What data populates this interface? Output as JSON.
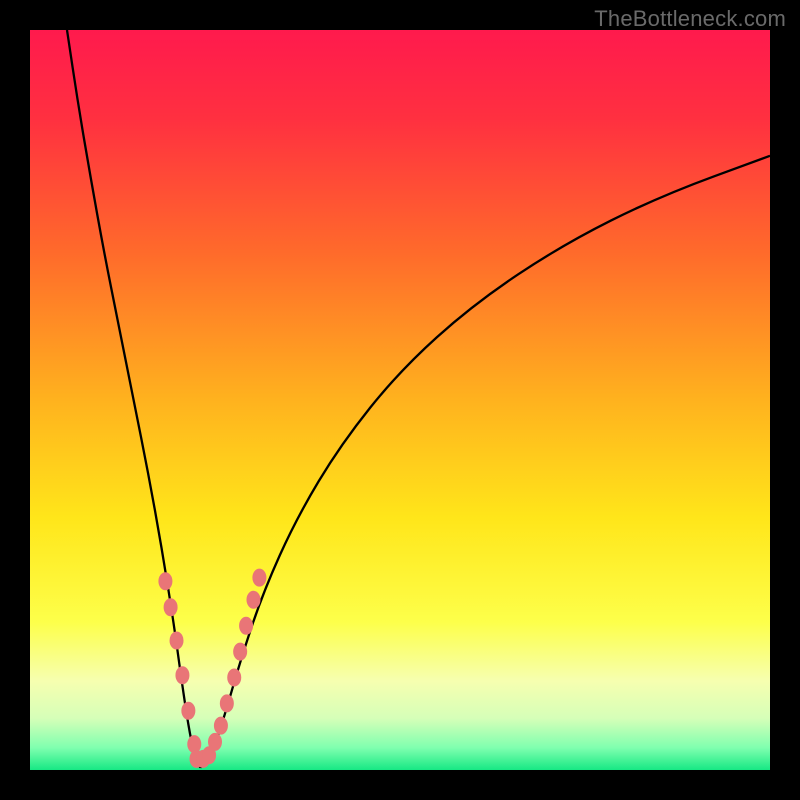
{
  "watermark": "TheBottleneck.com",
  "chart_data": {
    "type": "line",
    "title": "",
    "xlabel": "",
    "ylabel": "",
    "xrange": [
      0,
      100
    ],
    "yrange": [
      0,
      100
    ],
    "gradient_stops": [
      {
        "pos": 0.0,
        "color": "#ff1a4d"
      },
      {
        "pos": 0.12,
        "color": "#ff3040"
      },
      {
        "pos": 0.3,
        "color": "#ff6a2b"
      },
      {
        "pos": 0.5,
        "color": "#ffb21e"
      },
      {
        "pos": 0.66,
        "color": "#ffe61a"
      },
      {
        "pos": 0.8,
        "color": "#fdff4a"
      },
      {
        "pos": 0.88,
        "color": "#f6ffb0"
      },
      {
        "pos": 0.93,
        "color": "#d6ffb8"
      },
      {
        "pos": 0.97,
        "color": "#7fffaf"
      },
      {
        "pos": 1.0,
        "color": "#17e884"
      }
    ],
    "series": [
      {
        "name": "left_curve",
        "points": [
          {
            "x": 5.0,
            "y": 100.0
          },
          {
            "x": 6.5,
            "y": 90.0
          },
          {
            "x": 8.2,
            "y": 80.0
          },
          {
            "x": 10.0,
            "y": 70.0
          },
          {
            "x": 12.0,
            "y": 60.0
          },
          {
            "x": 14.0,
            "y": 50.0
          },
          {
            "x": 16.0,
            "y": 40.0
          },
          {
            "x": 17.8,
            "y": 30.0
          },
          {
            "x": 19.4,
            "y": 20.0
          },
          {
            "x": 20.5,
            "y": 12.0
          },
          {
            "x": 21.4,
            "y": 6.0
          },
          {
            "x": 22.2,
            "y": 2.0
          },
          {
            "x": 23.0,
            "y": 0.3
          }
        ]
      },
      {
        "name": "right_curve",
        "points": [
          {
            "x": 23.0,
            "y": 0.3
          },
          {
            "x": 24.5,
            "y": 2.0
          },
          {
            "x": 26.2,
            "y": 7.0
          },
          {
            "x": 28.5,
            "y": 15.0
          },
          {
            "x": 31.5,
            "y": 24.0
          },
          {
            "x": 36.0,
            "y": 34.0
          },
          {
            "x": 42.0,
            "y": 44.0
          },
          {
            "x": 50.0,
            "y": 54.0
          },
          {
            "x": 60.0,
            "y": 63.0
          },
          {
            "x": 72.0,
            "y": 71.0
          },
          {
            "x": 85.0,
            "y": 77.5
          },
          {
            "x": 100.0,
            "y": 83.0
          }
        ]
      }
    ],
    "markers": {
      "color": "#e97577",
      "rx": 7,
      "ry": 9,
      "points": [
        {
          "x": 18.3,
          "y": 25.5
        },
        {
          "x": 19.0,
          "y": 22.0
        },
        {
          "x": 19.8,
          "y": 17.5
        },
        {
          "x": 20.6,
          "y": 12.8
        },
        {
          "x": 21.4,
          "y": 8.0
        },
        {
          "x": 22.2,
          "y": 3.5
        },
        {
          "x": 22.5,
          "y": 1.5
        },
        {
          "x": 23.4,
          "y": 1.5
        },
        {
          "x": 24.2,
          "y": 2.0
        },
        {
          "x": 25.0,
          "y": 3.8
        },
        {
          "x": 25.8,
          "y": 6.0
        },
        {
          "x": 26.6,
          "y": 9.0
        },
        {
          "x": 27.6,
          "y": 12.5
        },
        {
          "x": 28.4,
          "y": 16.0
        },
        {
          "x": 29.2,
          "y": 19.5
        },
        {
          "x": 30.2,
          "y": 23.0
        },
        {
          "x": 31.0,
          "y": 26.0
        }
      ]
    }
  }
}
